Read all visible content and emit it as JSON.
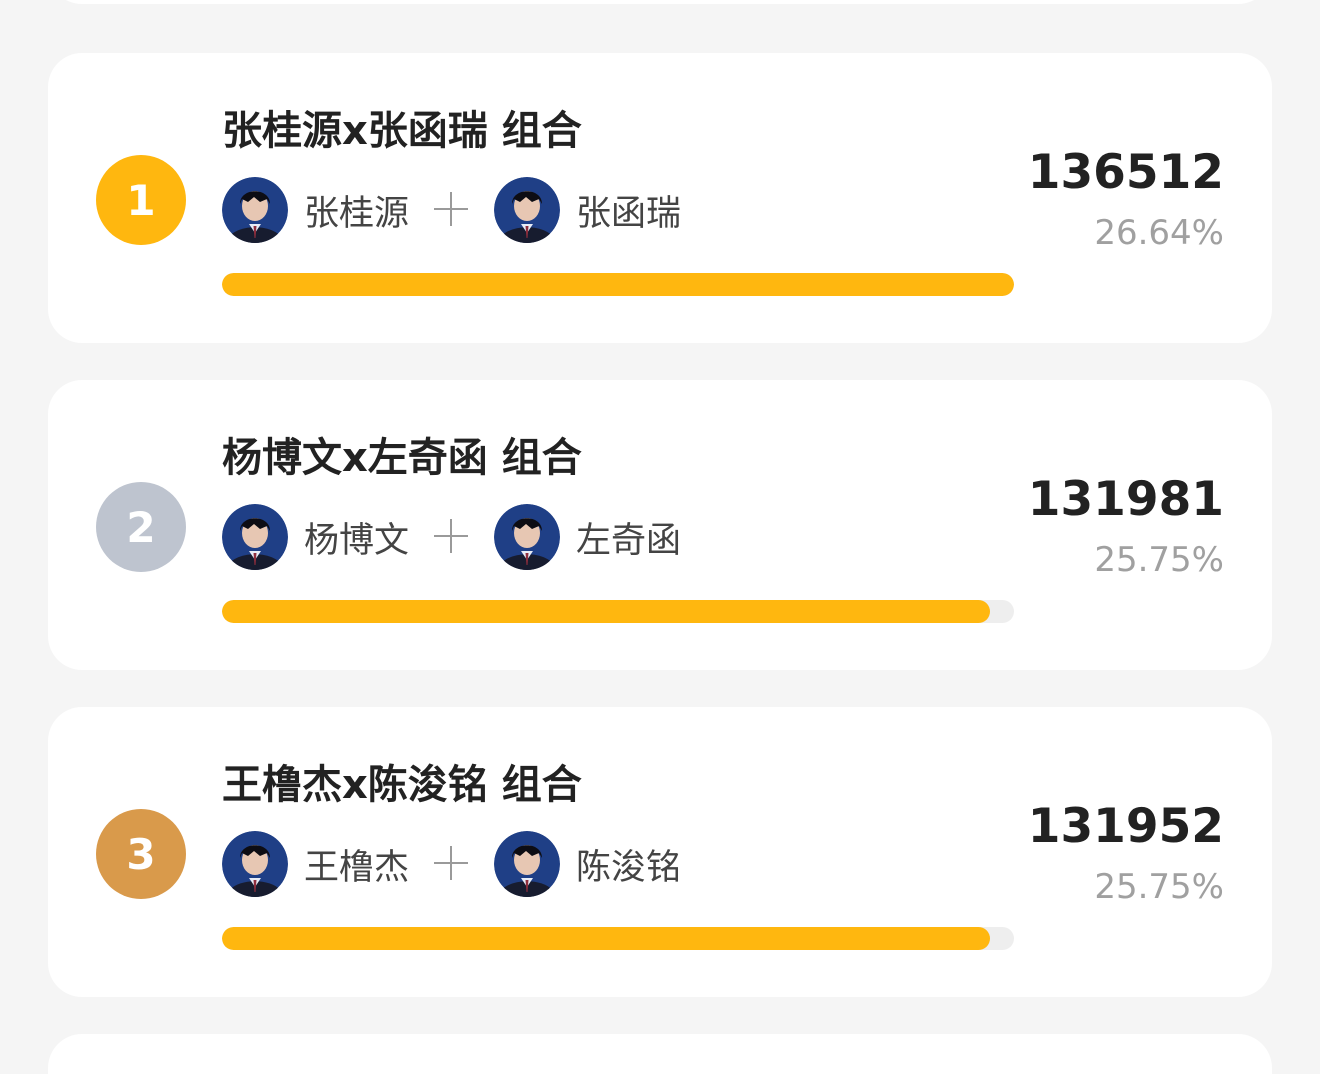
{
  "colors": {
    "page_background": "#f5f5f5",
    "card_background": "#ffffff",
    "progress_fill": "#ffb70f",
    "progress_track": "#eeeeee",
    "rank_1": "#ffb70f",
    "rank_2": "#bec4cf",
    "rank_3": "#d99a4b",
    "avatar_background": "#1f3f86"
  },
  "icons": {
    "plus": "plus-icon",
    "avatar": "avatar"
  },
  "rankings": [
    {
      "rank": "1",
      "title": "张桂源x张函瑞 组合",
      "member_a": "张桂源",
      "member_b": "张函瑞",
      "votes": "136512",
      "percent": "26.64%",
      "progress": 1.0
    },
    {
      "rank": "2",
      "title": "杨博文x左奇函 组合",
      "member_a": "杨博文",
      "member_b": "左奇函",
      "votes": "131981",
      "percent": "25.75%",
      "progress": 0.97
    },
    {
      "rank": "3",
      "title": "王橹杰x陈浚铭 组合",
      "member_a": "王橹杰",
      "member_b": "陈浚铭",
      "votes": "131952",
      "percent": "25.75%",
      "progress": 0.97
    }
  ]
}
